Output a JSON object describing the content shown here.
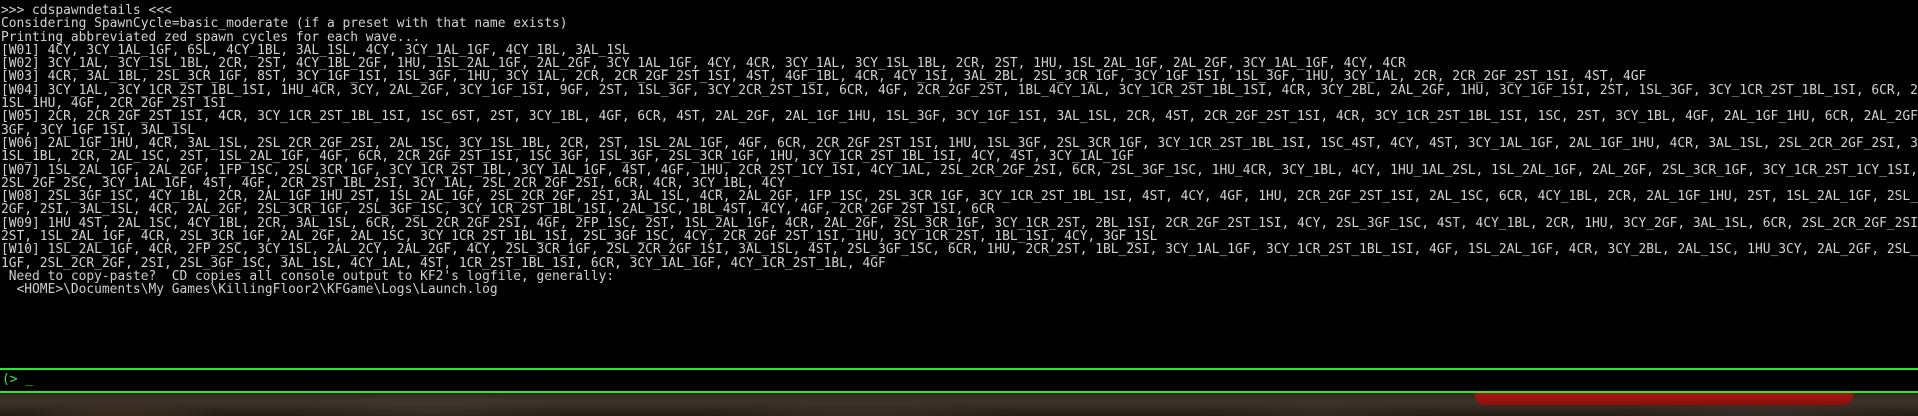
{
  "console": {
    "lines": [
      ">>> cdspawndetails <<<",
      "Considering SpawnCycle=basic_moderate (if a preset with that name exists)",
      "Printing abbreviated zed spawn cycles for each wave...",
      "[W01] 4CY, 3CY_1AL_1GF, 6SL, 4CY_1BL, 3AL_1SL, 4CY, 3CY_1AL_1GF, 4CY_1BL, 3AL_1SL",
      "[W02] 3CY_1AL, 3CY_1SL_1BL, 2CR, 2ST, 4CY_1BL_2GF, 1HU, 1SL_2AL_1GF, 2AL_2GF, 3CY_1AL_1GF, 4CY, 4CR, 3CY_1AL, 3CY_1SL_1BL, 2CR, 2ST, 1HU, 1SL_2AL_1GF, 2AL_2GF, 3CY_1AL_1GF, 4CY, 4CR",
      "[W03] 4CR, 3AL_1BL, 2SL_3CR_1GF, 8ST, 3CY_1GF_1SI, 1SL_3GF, 1HU, 3CY_1AL, 2CR, 2CR_2GF_2ST_1SI, 4ST, 4GF_1BL, 4CR, 4CY_1SI, 3AL_2BL, 2SL_3CR_1GF, 3CY_1GF_1SI, 1SL_3GF, 1HU, 3CY_1AL, 2CR, 2CR_2GF_2ST_1SI, 4ST, 4GF",
      "[W04] 3CY_1AL, 3CY_1CR_2ST_1BL_1SI, 1HU_4CR, 3CY, 2AL_2GF, 3CY_1GF_1SI, 9GF, 2ST, 1SL_3GF, 3CY_2CR_2ST_1SI, 6CR, 4GF, 2CR_2GF_2ST, 1BL_4CY_1AL, 3CY_1CR_2ST_1BL_1SI, 4CR, 3CY_2BL, 2AL_2GF, 1HU, 3CY_1GF_1SI, 2ST, 1SL_3GF, 3CY_1CR_2ST_1BL_1SI, 6CR, 2CY_",
      "1SL_1HU, 4GF, 2CR_2GF_2ST_1SI",
      "[W05] 2CR, 2CR_2GF_2ST_1SI, 4CR, 3CY_1CR_2ST_1BL_1SI, 1SC_6ST, 2ST, 3CY_1BL, 4GF, 6CR, 4ST, 2AL_2GF, 2AL_1GF_1HU, 1SL_3GF, 3CY_1GF_1SI, 3AL_1SL, 2CR, 4ST, 2CR_2GF_2ST_1SI, 4CR, 3CY_1CR_2ST_1BL_1SI, 1SC, 2ST, 3CY_1BL, 4GF, 2AL_1GF_1HU, 6CR, 2AL_2GF, 1SL_",
      "3GF, 3CY_1GF_1SI, 3AL_1SL",
      "[W06] 2AL_1GF_1HU, 4CR, 3AL_1SL, 2SL_2CR_2GF_2SI, 2AL_1SC, 3CY_1SL_1BL, 2CR, 2ST, 1SL_2AL_1GF, 4GF, 6CR, 2CR_2GF_2ST_1SI, 1HU, 1SL_3GF, 2SL_3CR_1GF, 3CY_1CR_2ST_1BL_1SI, 1SC_4ST, 4CY, 4ST, 3CY_1AL_1GF, 2AL_1GF_1HU, 4CR, 3AL_1SL, 2SL_2CR_2GF_2SI, 3CY_",
      "1SL_1BL, 2CR, 2AL_1SC, 2ST, 1SL_2AL_1GF, 4GF, 6CR, 2CR_2GF_2ST_1SI, 1SC_3GF, 1SL_3GF, 2SL_3CR_1GF, 1HU, 3CY_1CR_2ST_1BL_1SI, 4CY, 4ST, 3CY_1AL_1GF",
      "[W07] 1SL_2AL_1GF, 2AL_2GF, 1FP_1SC, 2SL_3CR_1GF, 3CY_1CR_2ST_1BL, 3CY_1AL_1GF, 4ST, 4GF, 1HU, 2CR_2ST_1CY_1SI, 4CY_1AL, 2SL_2CR_2GF_2SI, 6CR, 2SL_3GF_1SC, 1HU_4CR, 3CY_1BL, 4CY, 1HU_1AL_2SL, 1SL_2AL_1GF, 2AL_2GF, 2SL_3CR_1GF, 3CY_1CR_2ST_1CY_1SI,",
      "2SL_2GF_2SC, 3CY_1AL_1GF, 4ST, 4GF, 2CR_2ST_1BL_2SI, 3CY_1AL, 2SL_2CR_2GF_2SI, 6CR, 4CR, 3CY_1BL, 4CY",
      "[W08] 2SL_3GF_1SC, 4CY_1BL, 2CR, 2AL_1GF_1HU_2ST, 1SL_2AL_1GF, 2SL_2CR_2GF, 2SI, 3AL_1SL, 4CR, 2AL_2GF, 1FP_1SC, 2SL_3CR_1GF, 3CY_1CR_2ST_1BL_1SI, 4ST, 4CY, 4GF, 1HU, 2CR_2GF_2ST_1SI, 2AL_1SC, 6CR, 4CY_1BL, 2CR, 2AL_1GF_1HU, 2ST, 1SL_2AL_1GF, 2SL_2CR_",
      "2GF, 2SI, 3AL_1SL, 4CR, 2AL_2GF, 2SL_3CR_1GF, 2SL_3GF_1SC, 3CY_1CR_2ST_1BL_1SI, 2AL_1SC, 1BL_4ST, 4CY, 4GF, 2CR_2GF_2ST_1SI, 6CR",
      "[W09] 1HU_4ST, 2AL_1SC, 4CY_1BL, 2CR, 3AL_1SL, 6CR, 2SL_2CR_2GF_2SI, 4GF, 2FP_1SC, 2ST, 1SL_2AL_1GF, 4CR, 2AL_2GF, 2SL_3CR_1GF, 3CY_1CR_2ST, 2BL_1SI, 2CR_2GF_2ST_1SI, 4CY, 2SL_3GF_1SC, 4ST, 4CY_1BL, 2CR, 1HU, 3CY_2GF, 3AL_1SL, 6CR, 2SL_2CR_2GF_2SI, 4GF,",
      "2ST, 1SL_2AL_1GF, 4CR, 2SL_3CR_1GF, 2AL_2GF, 2AL_1SC, 3CY_1CR_2ST_1BL_1SI, 2SL_3GF_1SC, 4CY, 2CR_2GF_2ST_1SI, 1HU, 3CY_1CR_2ST, 1BL_1SI, 4CY, 3GF_1SL",
      "[W10] 1SL_2AL_1GF, 4CR, 2FP_2SC, 3CY_1SL, 2AL_2CY, 2AL_2GF, 4CY, 2SL_3CR_1GF, 2SL_2CR_2GF_1SI, 3AL_1SL, 4ST, 2SL_3GF_1SC, 6CR, 1HU, 2CR_2ST, 1BL_2SI, 3CY_1AL_1GF, 3CY_1CR_2ST_1BL_1SI, 4GF, 1SL_2AL_1GF, 4CR, 3CY_2BL, 2AL_1SC, 1HU_3CY, 2AL_2GF, 2SL_3CR_",
      "1GF, 2SL_2CR_2GF, 2SI, 2SL_3GF_1SC, 3AL_1SL, 4CY_1AL, 4ST, 1CR_2ST_1BL_1SI, 6CR, 3CY_1AL_1GF, 4CY_1CR_2ST_1BL, 4GF",
      " Need to copy-paste?  CD copies all console output to KF2's logfile, generally:",
      "  <HOME>\\Documents\\My Games\\KillingFloor2\\KFGame\\Logs\\Launch.log"
    ],
    "input_prompt": "(> _"
  },
  "colors": {
    "console_background": "#000000",
    "console_text": "#d2d2d2",
    "console_border": "#33e433",
    "prompt_text": "#41ea41",
    "hud_red": "#a81612"
  },
  "icons": {
    "prompt": "console-prompt-glyph"
  }
}
